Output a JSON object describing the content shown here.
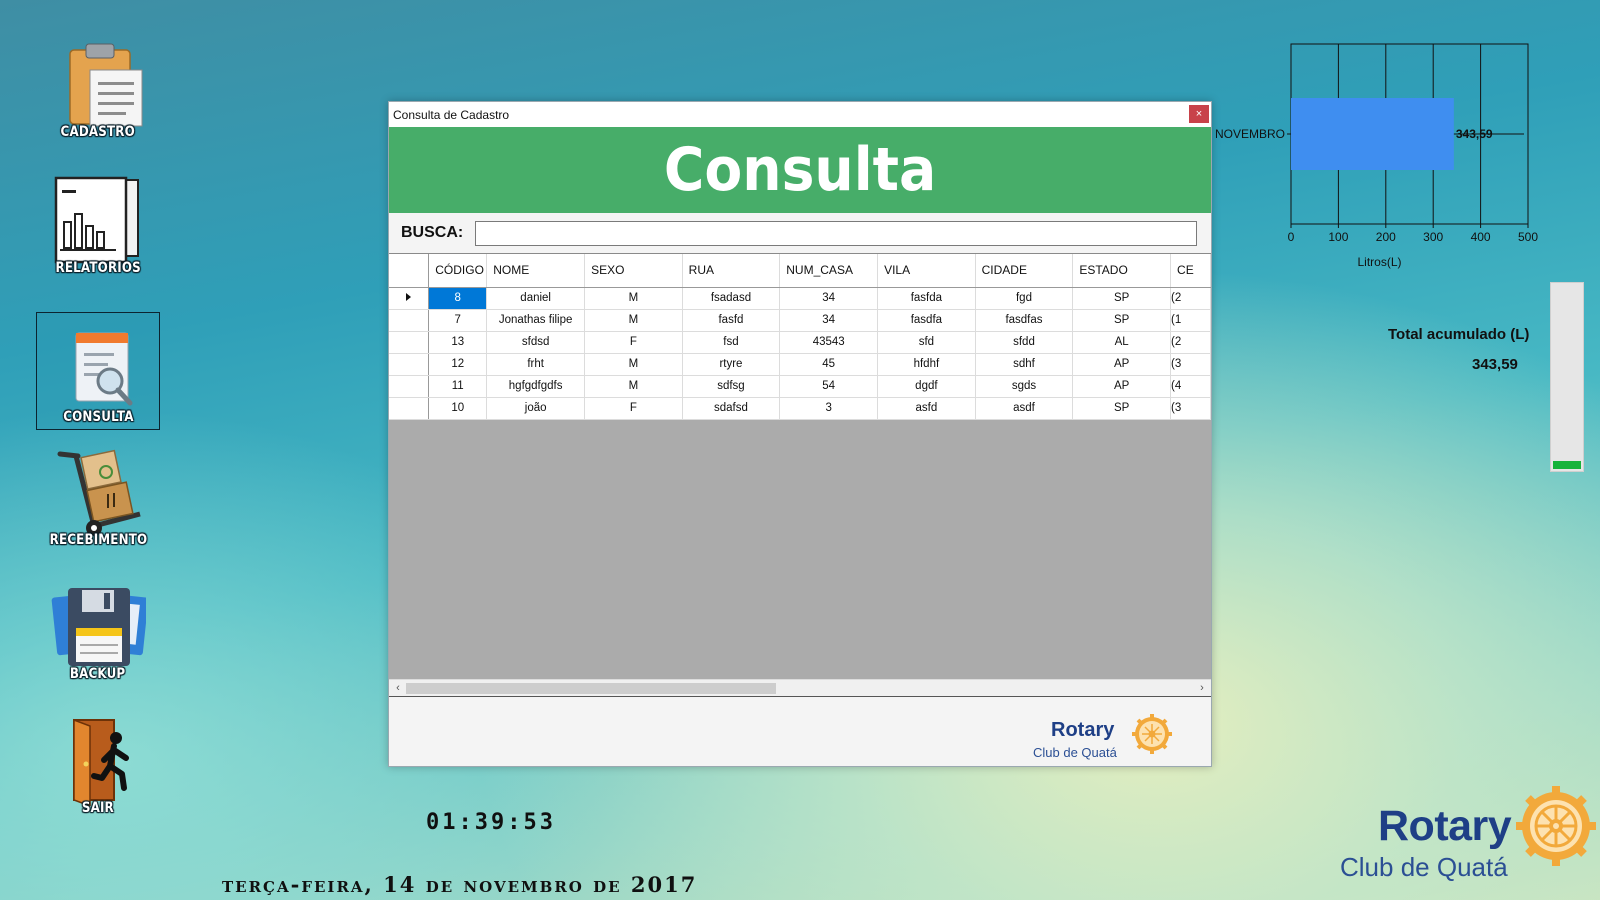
{
  "desktop": {
    "launchers": [
      {
        "label": "CADASTRO",
        "icon": "clipboard-icon"
      },
      {
        "label": "RELATORIOS",
        "icon": "report-chart-icon"
      },
      {
        "label": "CONSULTA",
        "icon": "search-document-icon"
      },
      {
        "label": "RECEBIMENTO",
        "icon": "hand-truck-icon"
      },
      {
        "label": "BACKUP",
        "icon": "floppy-disk-icon"
      },
      {
        "label": "SAiR",
        "icon": "exit-door-icon"
      }
    ],
    "clock": "01:39:53",
    "date": "terça-feira, 14 de novembro de 2017",
    "brand": {
      "name": "Rotary",
      "sub": "Club de Quatá",
      "color": "#1e3f86",
      "gear_color": "#f2a93b"
    }
  },
  "chart_data": {
    "type": "bar",
    "orientation": "horizontal",
    "categories": [
      "NOVEMBRO"
    ],
    "values": [
      343.59
    ],
    "data_labels": [
      "343,59"
    ],
    "xlabel": "Litros(L)",
    "ylabel": "",
    "xlim": [
      0,
      500
    ],
    "xticks": [
      "0",
      "100",
      "200",
      "300",
      "400",
      "500"
    ],
    "grid": true,
    "bar_color": "#3f8ef0"
  },
  "total": {
    "label": "Total acumulado (L)",
    "value": "343,59",
    "gauge_level": 0.04,
    "gauge_color": "#17b33a"
  },
  "window": {
    "title": "Consulta de Cadastro",
    "close_glyph": "×",
    "banner": "Consulta",
    "banner_color": "#47ad69",
    "search_label": "BUSCA:",
    "search_value": "",
    "columns": [
      "CÓDIGO",
      "NOME",
      "SEXO",
      "RUA",
      "NUM_CASA",
      "VILA",
      "CIDADE",
      "ESTADO",
      "CE"
    ],
    "rows": [
      [
        "8",
        "daniel",
        "M",
        "fsadasd",
        "34",
        "fasfda",
        "fgd",
        "SP",
        "(2"
      ],
      [
        "7",
        "Jonathas filipe",
        "M",
        "fasfd",
        "34",
        "fasdfa",
        "fasdfas",
        "SP",
        "(1"
      ],
      [
        "13",
        "sfdsd",
        "F",
        "fsd",
        "43543",
        "sfd",
        "sfdd",
        "AL",
        "(2"
      ],
      [
        "12",
        "frht",
        "M",
        "rtyre",
        "45",
        "hfdhf",
        "sdhf",
        "AP",
        "(3"
      ],
      [
        "11",
        "hgfgdfgdfs",
        "M",
        "sdfsg",
        "54",
        "dgdf",
        "sgds",
        "AP",
        "(4"
      ],
      [
        "10",
        "joão",
        "F",
        "sdafsd",
        "3",
        "asfd",
        "asdf",
        "SP",
        "(3"
      ]
    ],
    "selected_row": 0,
    "footer_brand": {
      "name": "Rotary",
      "sub": "Club de Quatá"
    }
  }
}
